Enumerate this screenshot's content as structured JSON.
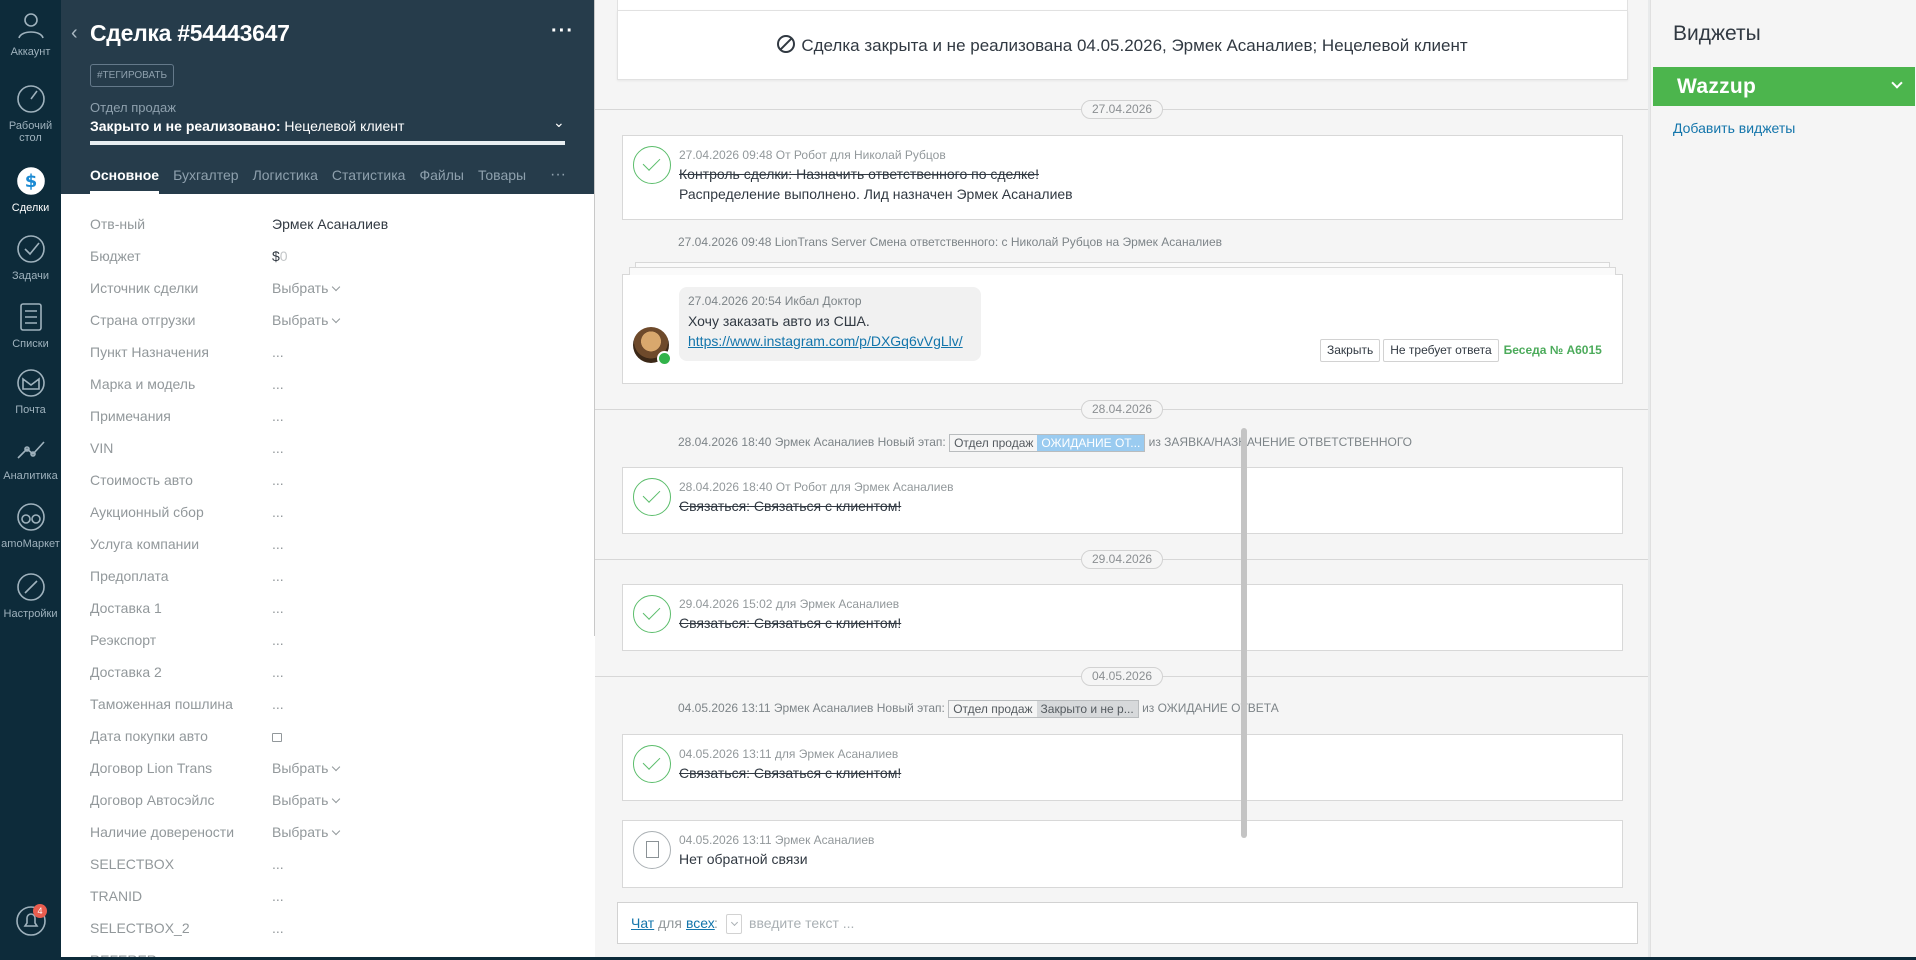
{
  "nav": {
    "items": [
      {
        "label": "Аккаунт",
        "icon": "account-icon"
      },
      {
        "label": "Рабочий стол",
        "icon": "dashboard-icon"
      },
      {
        "label": "Сделки",
        "icon": "deals-icon"
      },
      {
        "label": "Задачи",
        "icon": "tasks-icon"
      },
      {
        "label": "Списки",
        "icon": "lists-icon"
      },
      {
        "label": "Почта",
        "icon": "mail-icon"
      },
      {
        "label": "Аналитика",
        "icon": "analytics-icon"
      },
      {
        "label": "amoМаркет",
        "icon": "market-icon"
      },
      {
        "label": "Настройки",
        "icon": "settings-icon"
      }
    ],
    "notifications_count": "4"
  },
  "card": {
    "title": "Сделка #54443647",
    "tag_button": "#ТЕГИРОВАТЬ",
    "pipeline_label": "Отдел продаж",
    "pipeline_status_bold": "Закрыто и не реализовано:",
    "pipeline_status_reason": " Нецелевой клиент",
    "tabs": [
      "Основное",
      "Бухгалтер",
      "Логистика",
      "Статистика",
      "Файлы",
      "Товары"
    ],
    "fields": [
      {
        "label": "Отв-ный",
        "value": "Эрмек Асаналиев",
        "kind": "text"
      },
      {
        "label": "Бюджет",
        "value": "$",
        "value2": "0",
        "kind": "budget"
      },
      {
        "label": "Источник сделки",
        "value": "Выбрать",
        "kind": "select"
      },
      {
        "label": "Страна отгрузки",
        "value": "Выбрать",
        "kind": "select"
      },
      {
        "label": "Пункт Назначения",
        "value": "...",
        "kind": "empty"
      },
      {
        "label": "Марка и модель",
        "value": "...",
        "kind": "empty"
      },
      {
        "label": "Примечания",
        "value": "...",
        "kind": "empty"
      },
      {
        "label": "VIN",
        "value": "...",
        "kind": "empty"
      },
      {
        "label": "Стоимость авто",
        "value": "...",
        "kind": "empty"
      },
      {
        "label": "Аукционный сбор",
        "value": "...",
        "kind": "empty"
      },
      {
        "label": "Услуга компании",
        "value": "...",
        "kind": "empty"
      },
      {
        "label": "Предоплата",
        "value": "...",
        "kind": "empty"
      },
      {
        "label": "Доставка 1",
        "value": "...",
        "kind": "empty"
      },
      {
        "label": "Реэкспорт",
        "value": "...",
        "kind": "empty"
      },
      {
        "label": "Доставка 2",
        "value": "...",
        "kind": "empty"
      },
      {
        "label": "Таможенная пошлина",
        "value": "...",
        "kind": "empty"
      },
      {
        "label": "Дата покупки авто",
        "value": "",
        "kind": "date"
      },
      {
        "label": "Договор Lion Trans",
        "value": "Выбрать",
        "kind": "select"
      },
      {
        "label": "Договор Автосэйлс",
        "value": "Выбрать",
        "kind": "select"
      },
      {
        "label": "Наличие доверености",
        "value": "Выбрать",
        "kind": "select"
      },
      {
        "label": "SELECTBOX",
        "value": "...",
        "kind": "empty"
      },
      {
        "label": "TRANID",
        "value": "...",
        "kind": "empty"
      },
      {
        "label": "SELECTBOX_2",
        "value": "...",
        "kind": "empty"
      },
      {
        "label": "REFERER",
        "value": "",
        "kind": "empty"
      }
    ]
  },
  "feed": {
    "closed_banner": "Сделка закрыта и не реализована 04.05.2026, Эрмек Асаналиев; Нецелевой клиент",
    "dates": [
      "27.04.2026",
      "28.04.2026",
      "29.04.2026",
      "04.05.2026"
    ],
    "task1": {
      "meta": "27.04.2026 09:48  От Робот для Николай Рубцов",
      "line1": "Контроль сделки: Назначить ответственного по сделке!",
      "line2": "Распределение выполнено. Лид назначен Эрмек Асаналиев"
    },
    "event1": "27.04.2026 09:48 LionTrans Server Смена ответственного: с Николай Рубцов на Эрмек Асаналиев",
    "chat": {
      "meta": "27.04.2026 20:54 Икбал Доктор",
      "message": "Хочу заказать авто из США.",
      "link": "https://www.instagram.com/p/DXGq6vVgLlv/",
      "close_btn": "Закрыть",
      "no_reply_btn": "Не требует ответа",
      "conversation": "Беседа № А6015"
    },
    "event2": {
      "prefix": "28.04.2026 18:40 Эрмек Асаналиев Новый этап:",
      "stage_pipeline": "Отдел продаж",
      "stage_value": "ОЖИДАНИЕ ОТ...",
      "suffix": "из ЗАЯВКА/НАЗНАЧЕНИЕ ОТВЕТСТВЕННОГО"
    },
    "task2": {
      "meta": "28.04.2026 18:40  От Робот для Эрмек Асаналиев",
      "text": "Связаться: Связаться с клиентом!"
    },
    "task3": {
      "meta": "29.04.2026 15:02  для Эрмек Асаналиев",
      "text": "Связаться: Связаться с клиентом!"
    },
    "event3": {
      "prefix": "04.05.2026 13:11 Эрмек Асаналиев Новый этап:",
      "stage_pipeline": "Отдел продаж",
      "stage_value": "Закрыто и не р...",
      "suffix": "из ОЖИДАНИЕ ОТВЕТА"
    },
    "task4": {
      "meta": "04.05.2026 13:11  для Эрмек Асаналиев",
      "text": "Связаться: Связаться с клиентом!"
    },
    "note": {
      "meta": "04.05.2026 13:11 Эрмек Асаналиев",
      "text": "Нет обратной связи"
    },
    "composer": {
      "chat": "Чат",
      "for": "для",
      "all": "всех",
      "colon": ":",
      "placeholder": "введите текст ..."
    }
  },
  "widgets": {
    "title": "Виджеты",
    "wazzup": "Wazzup",
    "add": "Добавить виджеты"
  },
  "colors": {
    "nav_bg": "#0d2b3a",
    "card_head_bg": "#263c4b",
    "accent_green": "#4cb54d",
    "link_blue": "#1375ab",
    "stage_highlight": "#9acbf0"
  }
}
